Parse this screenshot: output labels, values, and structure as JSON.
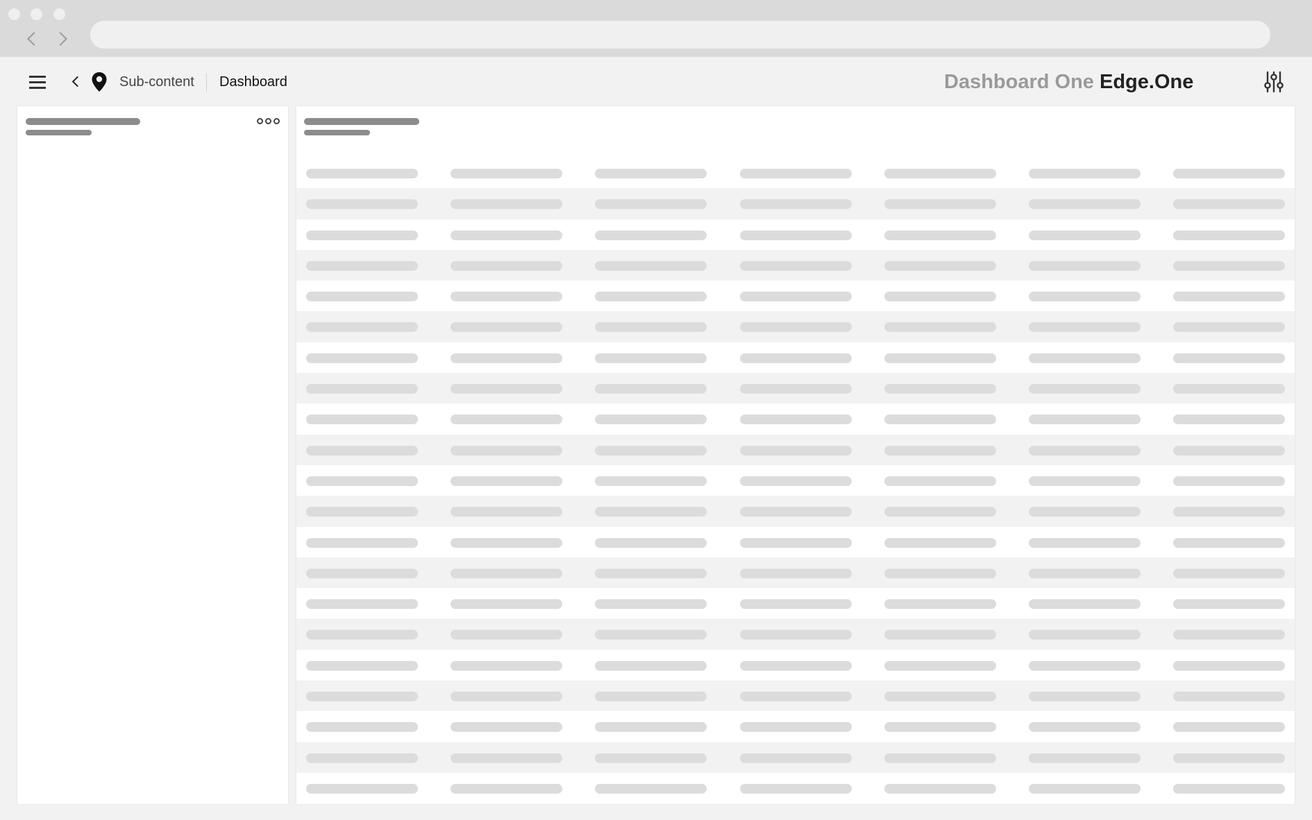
{
  "browser": {
    "window_controls": [
      "close-dot",
      "minimize-dot",
      "maximize-dot"
    ],
    "nav_icons": [
      "back-arrow-icon",
      "forward-arrow-icon"
    ],
    "url": ""
  },
  "header": {
    "menu_icon": "hamburger-menu-icon",
    "back_icon": "chevron-left-icon",
    "location_icon": "map-pin-icon",
    "breadcrumb": {
      "parent": "Sub-content",
      "current": "Dashboard"
    },
    "brand": {
      "product": "Dashboard One",
      "company": "Edge.One"
    },
    "settings_icon": "sliders-icon"
  },
  "left_panel": {
    "more_icon": "more-options-icon"
  },
  "main_panel": {
    "table": {
      "columns": 7,
      "rows": 21
    }
  },
  "colors": {
    "chrome": "#dadada",
    "background": "#f2f2f2",
    "panel": "#ffffff",
    "placeholder_dark": "#8c8c8c",
    "placeholder_light": "#dcdcdc",
    "row_stripe": "#f2f2f2"
  }
}
